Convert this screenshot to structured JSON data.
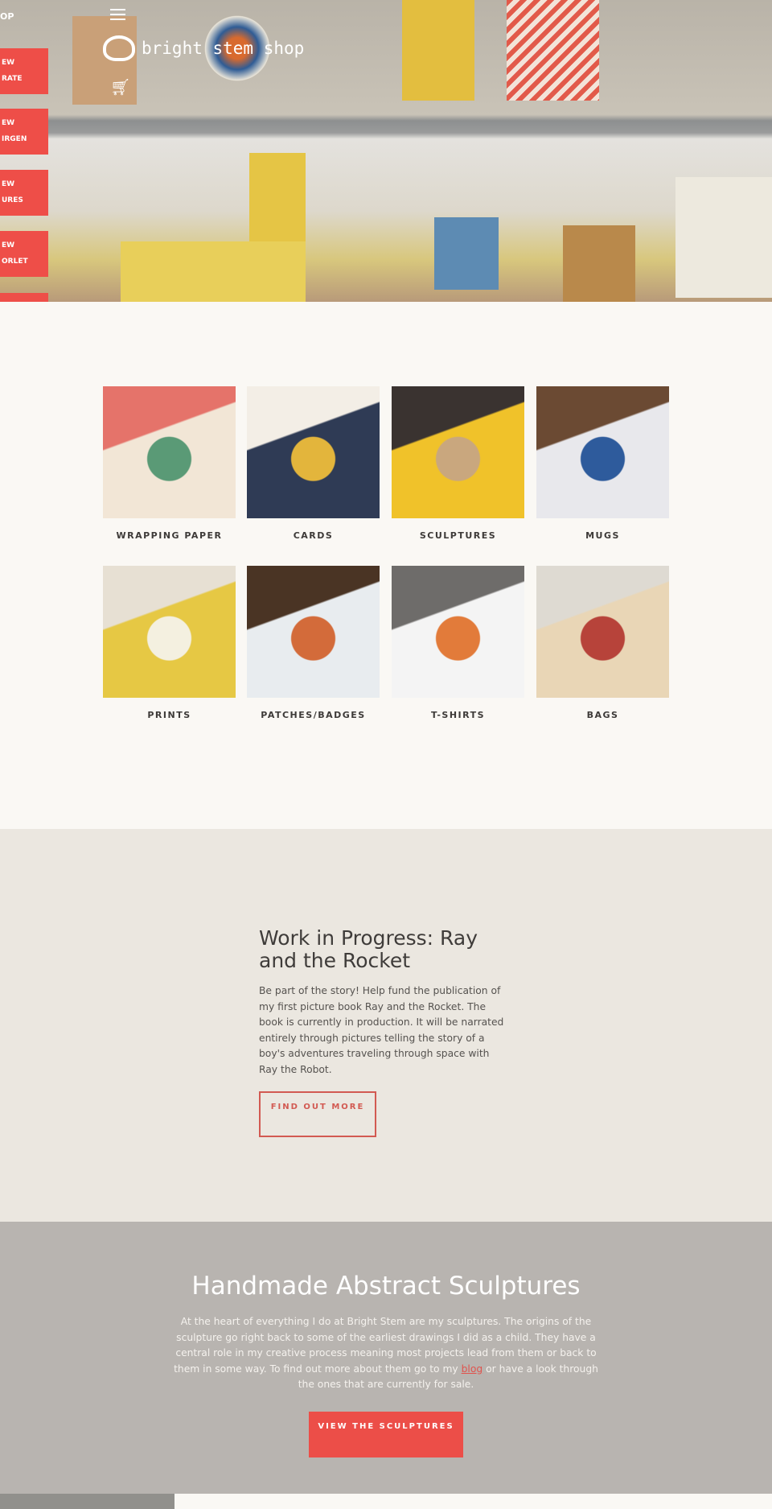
{
  "header": {
    "shop_label": "OP",
    "logo_text": "bright stem shop",
    "menu_icon": "hamburger-icon",
    "cart_icon": "cart-icon",
    "side_buttons": [
      {
        "line1": "EW",
        "line2": "RATE"
      },
      {
        "line1": "EW",
        "line2": "IRGEN"
      },
      {
        "line1": "EW",
        "line2": "URES"
      },
      {
        "line1": "EW",
        "line2": "ORLET"
      },
      {
        "line1": "",
        "line2": ""
      }
    ]
  },
  "categories": [
    {
      "label": "WRAPPING PAPER",
      "colors": [
        "#e5736a",
        "#f2e6d6",
        "#5a9a76"
      ]
    },
    {
      "label": "CARDS",
      "colors": [
        "#f3eee6",
        "#2f3b55",
        "#e3b53c"
      ]
    },
    {
      "label": "SCULPTURES",
      "colors": [
        "#3a3330",
        "#f0c22a",
        "#c9a77e"
      ]
    },
    {
      "label": "MUGS",
      "colors": [
        "#6b4a33",
        "#e8e8ec",
        "#2e5b9c"
      ]
    },
    {
      "label": "PRINTS",
      "colors": [
        "#e7e0d3",
        "#e6c844",
        "#f4f0e0"
      ]
    },
    {
      "label": "PATCHES/BADGES",
      "colors": [
        "#4a3424",
        "#e8ecef",
        "#d36b3a"
      ]
    },
    {
      "label": "T-SHIRTS",
      "colors": [
        "#6e6c6a",
        "#f4f4f4",
        "#e27b3a"
      ]
    },
    {
      "label": "BAGS",
      "colors": [
        "#dedad2",
        "#e9d6b6",
        "#b7433a"
      ]
    }
  ],
  "wip": {
    "title": "Work in Progress: Ray and the Rocket",
    "body": "Be part of the story! Help fund the publication of my first picture book Ray and the Rocket. The book is currently in production.  It will be narrated entirely through pictures telling the story of a boy's adventures traveling through space with Ray the Robot.",
    "button": "FIND OUT MORE"
  },
  "sculptures": {
    "title": "Handmade Abstract Sculptures",
    "body_before": "At the heart of everything I do at Bright Stem are my sculptures. The origins of the sculpture go right back to some of the earliest drawings I did as a child. They have a central role in my creative process meaning most projects lead from them or back to them in some way. To find out more about them go to my ",
    "link": "blog",
    "body_after": " or have a look through the ones that are currently for sale.",
    "button": "VIEW THE SCULPTURES"
  },
  "colors": {
    "accent": "#ec4e48",
    "section_bg": "#ebe7e0",
    "sculpture_bg": "#b8b4b0",
    "page_bg": "#faf8f4"
  }
}
